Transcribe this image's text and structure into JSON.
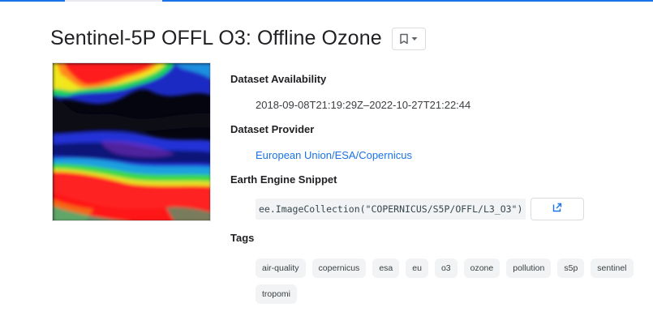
{
  "header": {
    "title": "Sentinel-5P OFFL O3: Offline Ozone",
    "bookmark_icon": "bookmark-icon",
    "dropdown_icon": "chevron-down-icon"
  },
  "thumbnail": {
    "alt": "ozone-heatmap-image"
  },
  "details": {
    "availability_label": "Dataset Availability",
    "availability_value": "2018-09-08T21:19:29Z–2022-10-27T21:22:44",
    "provider_label": "Dataset Provider",
    "provider_value": "European Union/ESA/Copernicus",
    "snippet_label": "Earth Engine Snippet",
    "snippet_value": "ee.ImageCollection(\"COPERNICUS/S5P/OFFL/L3_O3\")",
    "open_icon": "open-in-new-icon",
    "tags_label": "Tags"
  },
  "tags": [
    "air-quality",
    "copernicus",
    "esa",
    "eu",
    "o3",
    "ozone",
    "pollution",
    "s5p",
    "sentinel",
    "tropomi"
  ],
  "colors": {
    "accent": "#1a73e8",
    "chip_bg": "#f1f3f4"
  }
}
